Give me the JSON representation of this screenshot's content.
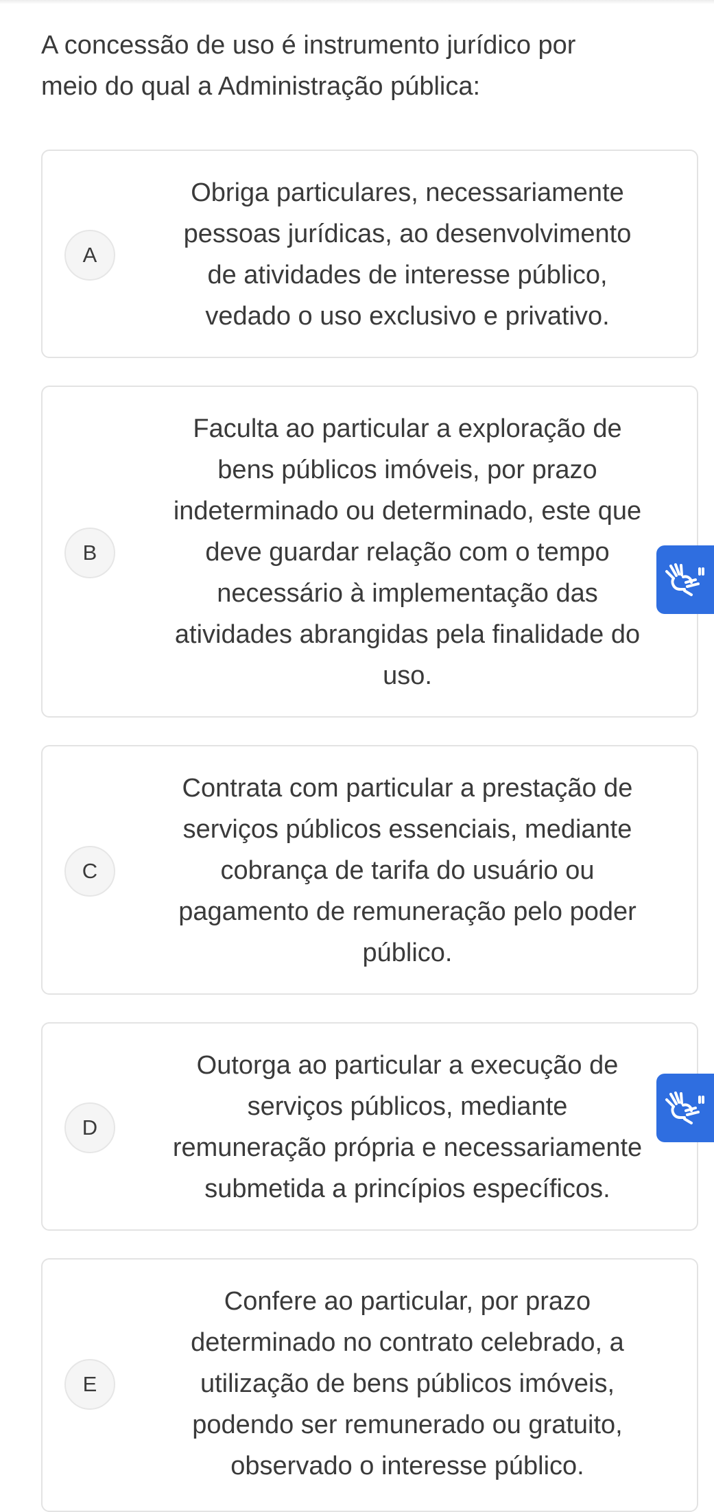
{
  "question": {
    "line1": "A concessão de uso é instrumento jurídico por",
    "line2": "meio do qual a Administração pública:"
  },
  "options": [
    {
      "letter": "A",
      "lines": [
        "Obriga particulares, necessariamente",
        "pessoas jurídicas, ao desenvolvimento",
        "de atividades de interesse público,",
        "vedado o uso exclusivo e privativo."
      ]
    },
    {
      "letter": "B",
      "lines": [
        "Faculta ao particular a exploração de",
        "bens públicos imóveis, por prazo",
        "indeterminado ou determinado, este que",
        "deve guardar relação com o tempo",
        "necessário à implementação das",
        "atividades abrangidas pela finalidade do",
        "uso."
      ]
    },
    {
      "letter": "C",
      "lines": [
        "Contrata com particular a prestação de",
        "serviços públicos essenciais, mediante",
        "cobrança de tarifa do usuário ou",
        "pagamento de remuneração pelo poder",
        "público."
      ]
    },
    {
      "letter": "D",
      "lines": [
        "Outorga ao particular a execução de",
        "serviços públicos, mediante",
        "remuneração própria e necessariamente",
        "submetida a princípios específicos."
      ]
    },
    {
      "letter": "E",
      "lines": [
        "Confere ao particular, por prazo",
        "determinado no contrato celebrado, a",
        "utilização de bens públicos imóveis,",
        "podendo ser remunerado ou gratuito,",
        "observado o interesse público."
      ]
    }
  ],
  "accessibility_widget": {
    "icon": "sign-language-hands-icon",
    "color": "#2f6ee0"
  }
}
